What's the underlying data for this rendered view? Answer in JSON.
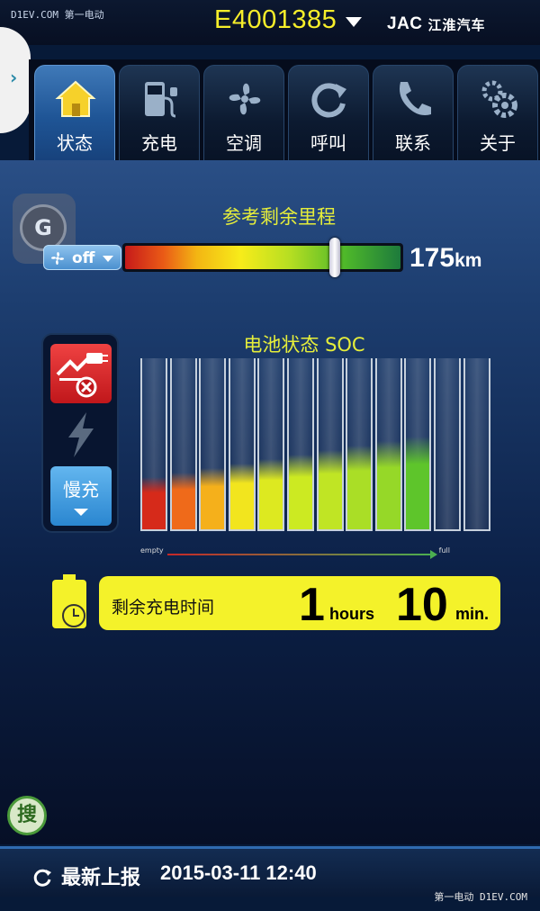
{
  "watermarks": {
    "top_left": "D1EV.COM 第一电动",
    "bottom_right": "第一电动 D1EV.COM"
  },
  "header": {
    "vehicle_id": "E4001385",
    "brand_logo": "JAC",
    "brand_name": "江淮汽车"
  },
  "tabs": [
    {
      "label": "状态",
      "icon": "home-icon",
      "active": true
    },
    {
      "label": "充电",
      "icon": "charger-icon",
      "active": false
    },
    {
      "label": "空调",
      "icon": "fan-icon",
      "active": false
    },
    {
      "label": "呼叫",
      "icon": "refresh-icon",
      "active": false
    },
    {
      "label": "联系",
      "icon": "phone-icon",
      "active": false
    },
    {
      "label": "关于",
      "icon": "gear-icon",
      "active": false
    }
  ],
  "range": {
    "title": "参考剩余里程",
    "ac_status": "off",
    "value": "175",
    "unit": "km",
    "level": 0.76
  },
  "soc": {
    "title": "电池状态 SOC",
    "empty_label": "empty",
    "full_label": "full",
    "segments": 12,
    "filled_segments": 10,
    "colors": [
      "#d62a1a",
      "#ef6a1a",
      "#f5b01b",
      "#f2e51e",
      "#dde920",
      "#ccea22",
      "#c0e524",
      "#aade26",
      "#96d828",
      "#5ec52b"
    ]
  },
  "charge_status": {
    "mode_label": "慢充",
    "plug_state": "disconnected"
  },
  "remaining_time": {
    "label": "剩余充电时间",
    "hours": "1",
    "hours_unit": "hours",
    "minutes": "10",
    "minutes_unit": "min."
  },
  "search_label": "搜",
  "side_widget": "G",
  "footer": {
    "label": "最新上报",
    "timestamp": "2015-03-11 12:40"
  },
  "colors": {
    "accent": "#f4f22a",
    "title": "#e6ee3a",
    "tab_active": "#2b66a9"
  }
}
